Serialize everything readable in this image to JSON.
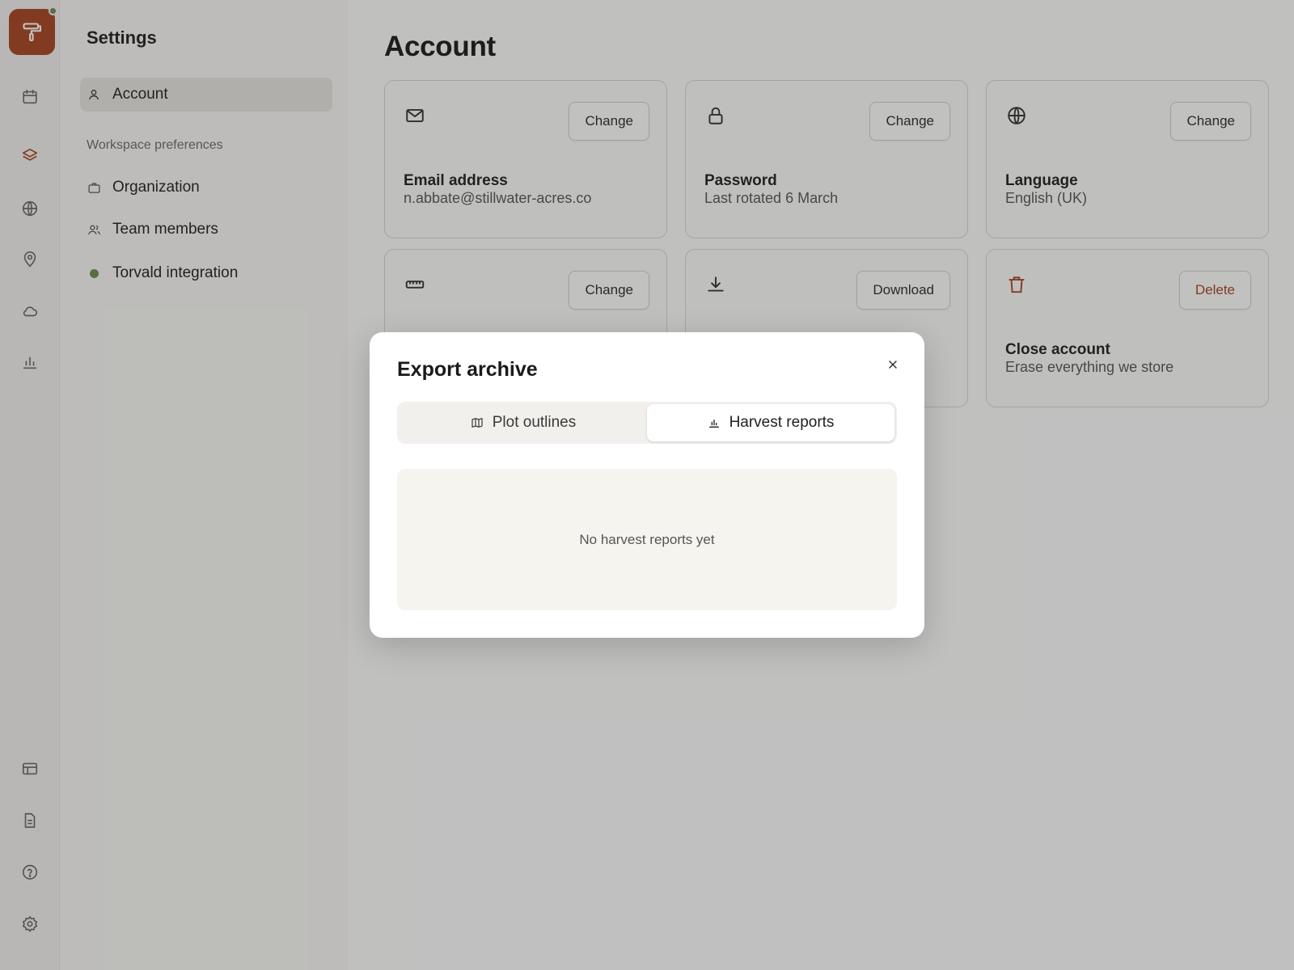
{
  "colors": {
    "brand": "#a5431f",
    "online": "#6b8a4e",
    "background": "#fbfbfa"
  },
  "rail": {
    "logo_icon": "paint-roller-icon",
    "top_icons": [
      "calendar-icon",
      "layers-icon",
      "globe-icon",
      "map-pin-icon",
      "cloud-icon",
      "bar-chart-icon"
    ],
    "bottom_icons": [
      "table-icon",
      "document-icon",
      "help-icon",
      "settings-icon"
    ],
    "active": "layers-icon"
  },
  "sidebar": {
    "title": "Settings",
    "account_label": "Account",
    "section_label": "Workspace preferences",
    "items": [
      {
        "label": "Organization",
        "icon": "briefcase-icon"
      },
      {
        "label": "Team members",
        "icon": "users-icon"
      },
      {
        "label": "Torvald integration",
        "icon": "status-dot"
      }
    ]
  },
  "main": {
    "title": "Account",
    "cards": [
      {
        "icon": "mail-icon",
        "button": "Change",
        "title": "Email address",
        "subtitle": "n.abbate@stillwater-acres.co"
      },
      {
        "icon": "lock-icon",
        "button": "Change",
        "title": "Password",
        "subtitle": "Last rotated 6 March"
      },
      {
        "icon": "globe-icon",
        "button": "Change",
        "title": "Language",
        "subtitle": "English (UK)"
      },
      {
        "icon": "ruler-icon",
        "button": "Change",
        "title": "",
        "subtitle": ""
      },
      {
        "icon": "download-icon",
        "button": "Download",
        "title": "",
        "subtitle": ""
      },
      {
        "icon": "trash-icon",
        "button": "Delete",
        "title": "Close account",
        "subtitle": "Erase everything we store"
      }
    ]
  },
  "modal": {
    "title": "Export archive",
    "tabs": [
      {
        "label": "Plot outlines",
        "icon": "map-icon",
        "selected": false
      },
      {
        "label": "Harvest reports",
        "icon": "bar-chart-icon",
        "selected": true
      }
    ],
    "empty_message": "No harvest reports yet"
  }
}
